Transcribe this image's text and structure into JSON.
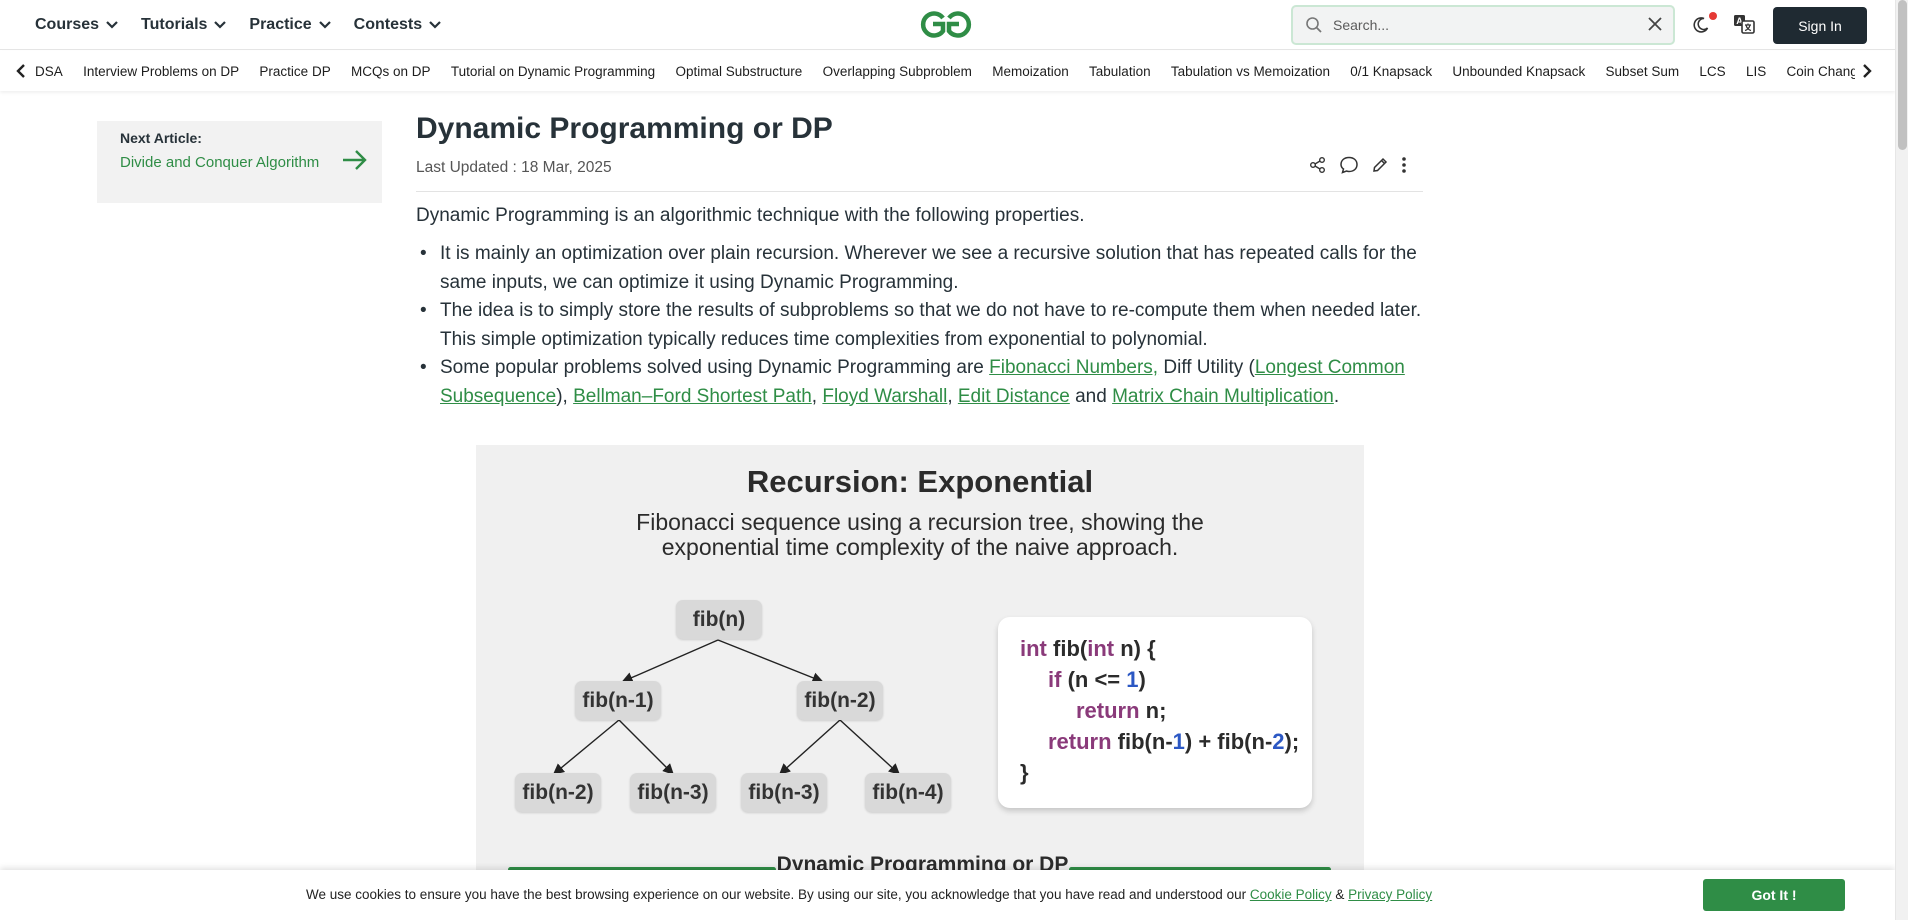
{
  "header": {
    "nav": [
      {
        "label": "Courses"
      },
      {
        "label": "Tutorials"
      },
      {
        "label": "Practice"
      },
      {
        "label": "Contests"
      }
    ],
    "search_placeholder": "Search...",
    "signin_label": "Sign In",
    "brand_color": "#2f8d46"
  },
  "subnav": {
    "items": [
      "DSA",
      "Interview Problems on DP",
      "Practice DP",
      "MCQs on DP",
      "Tutorial on Dynamic Programming",
      "Optimal Substructure",
      "Overlapping Subproblem",
      "Memoization",
      "Tabulation",
      "Tabulation vs Memoization",
      "0/1 Knapsack",
      "Unbounded Knapsack",
      "Subset Sum",
      "LCS",
      "LIS",
      "Coin Change"
    ]
  },
  "aside": {
    "next_label": "Next Article:",
    "next_title": "Divide and Conquer Algorithm"
  },
  "article": {
    "title": "Dynamic Programming or DP",
    "last_updated": "Last Updated : 18 Mar, 2025",
    "intro": "Dynamic Programming is an algorithmic technique with the following properties.",
    "bullet1": "It is mainly an optimization over plain recursion. Wherever we see a recursive solution that has repeated calls for the same inputs, we can optimize it using Dynamic Programming.",
    "bullet2": "The idea is to simply store the results of subproblems so that we do not have to re-compute them when needed later. This simple optimization typically reduces time complexities from exponential to polynomial.",
    "bullet3": {
      "t1": "Some popular problems solved using Dynamic Programming are ",
      "link1": "Fibonacci Numbers,",
      "t2": " Diff Utility (",
      "link2": "Longest Common Subsequence",
      "t3": "), ",
      "link3": "Bellman–Ford Shortest Path",
      "t4": ", ",
      "link4": "Floyd Warshall",
      "t5": ", ",
      "link5": "Edit Distance",
      "t6": " and ",
      "link6": "Matrix Chain Multiplication",
      "t7": "."
    }
  },
  "figure": {
    "title": "Recursion: Exponential",
    "subtitle": "Fibonacci sequence using a recursion tree, showing the exponential time complexity of the naive approach.",
    "nodes": {
      "root": "fib(n)",
      "l1": "fib(n-1)",
      "r1": "fib(n-2)",
      "l2a": "fib(n-2)",
      "l2b": "fib(n-3)",
      "r2a": "fib(n-3)",
      "r2b": "fib(n-4)"
    },
    "code": {
      "l1_kw1": "int",
      "l1_a": " fib(",
      "l1_kw2": "int",
      "l1_b": " n) {",
      "l2_kw": "if",
      "l2_a": " (n <= ",
      "l2_num": "1",
      "l2_b": ")",
      "l3_kw": "return",
      "l3_a": " n;",
      "l4_kw": "return",
      "l4_a": " fib(n-",
      "l4_n1": "1",
      "l4_b": ") + fib(n-",
      "l4_n2": "2",
      "l4_c": ");",
      "l5": "}"
    },
    "bottom_label": "Dynamic Programming or DP"
  },
  "cookie": {
    "text": "We use cookies to ensure you have the best browsing experience on our website. By using our site, you acknowledge that you have read and understood our ",
    "cookie_policy": "Cookie Policy",
    "amp": " & ",
    "privacy_policy": "Privacy Policy",
    "button": "Got It !"
  }
}
